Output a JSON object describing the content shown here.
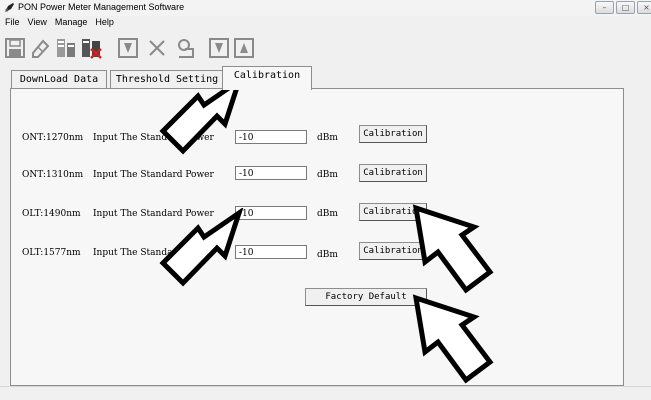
{
  "window": {
    "title": "PON Power Meter Management Software",
    "controls": [
      "minimize",
      "maximize",
      "close"
    ]
  },
  "menu": [
    "File",
    "View",
    "Manage",
    "Help"
  ],
  "toolbar": {
    "icons": [
      "save-icon",
      "erase-icon",
      "device-icon",
      "device-remove-icon",
      "download-icon",
      "delete-icon",
      "settings-icon",
      "download-icon",
      "upload-icon"
    ]
  },
  "tabs": [
    {
      "label": "DownLoad Data"
    },
    {
      "label": "Threshold Setting"
    },
    {
      "label": "Calibration",
      "active": true
    }
  ],
  "calibration": {
    "rows": [
      {
        "channel": "ONT:1270nm",
        "prompt": "Input The Standard Power",
        "value": "-10",
        "unit": "dBm",
        "button": "Calibration"
      },
      {
        "channel": "ONT:1310nm",
        "prompt": "Input The Standard Power",
        "value": "-10",
        "unit": "dBm",
        "button": "Calibration"
      },
      {
        "channel": "OLT:1490nm",
        "prompt": "Input The Standard Power",
        "value": "-10",
        "unit": "dBm",
        "button": "Calibration"
      },
      {
        "channel": "OLT:1577nm",
        "prompt": "Input The Standard Power",
        "value": "-10",
        "unit": "dBm",
        "button": "Calibration"
      }
    ],
    "factory_default": "Factory Default"
  },
  "colors": {
    "window_bg": "#f0f0f0",
    "panel_bg": "#f7f7f7",
    "toolbar_icon": "#8a8a8a",
    "border": "#8e8e8e"
  }
}
